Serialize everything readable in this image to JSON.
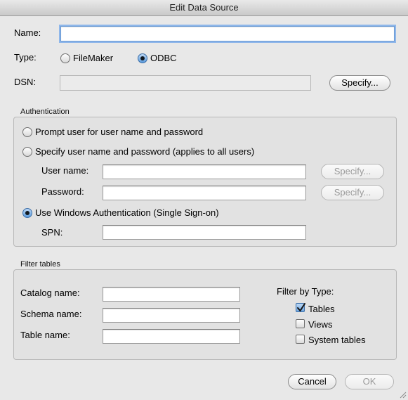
{
  "window": {
    "title": "Edit Data Source"
  },
  "name": {
    "label": "Name:",
    "value": "",
    "placeholder": ""
  },
  "type": {
    "label": "Type:",
    "options": [
      {
        "label": "FileMaker",
        "selected": false
      },
      {
        "label": "ODBC",
        "selected": true
      }
    ]
  },
  "dsn": {
    "label": "DSN:",
    "value": "",
    "specify_label": "Specify..."
  },
  "authentication": {
    "title": "Authentication",
    "prompt_option": "Prompt user for user name and password",
    "specify_option": "Specify user name and password (applies to all users)",
    "user_name_label": "User name:",
    "password_label": "Password:",
    "specify_label": "Specify...",
    "windows_option": "Use Windows Authentication (Single Sign-on)",
    "spn_label": "SPN:",
    "selected": "windows"
  },
  "filter": {
    "title": "Filter tables",
    "catalog_label": "Catalog name:",
    "schema_label": "Schema name:",
    "table_label": "Table name:",
    "by_type_label": "Filter by Type:",
    "types": [
      {
        "label": "Tables",
        "checked": true
      },
      {
        "label": "Views",
        "checked": false
      },
      {
        "label": "System tables",
        "checked": false
      }
    ]
  },
  "buttons": {
    "cancel": "Cancel",
    "ok": "OK"
  },
  "colors": {
    "focus_ring": "#8fb7ea",
    "window_bg": "#e8e8e8"
  }
}
